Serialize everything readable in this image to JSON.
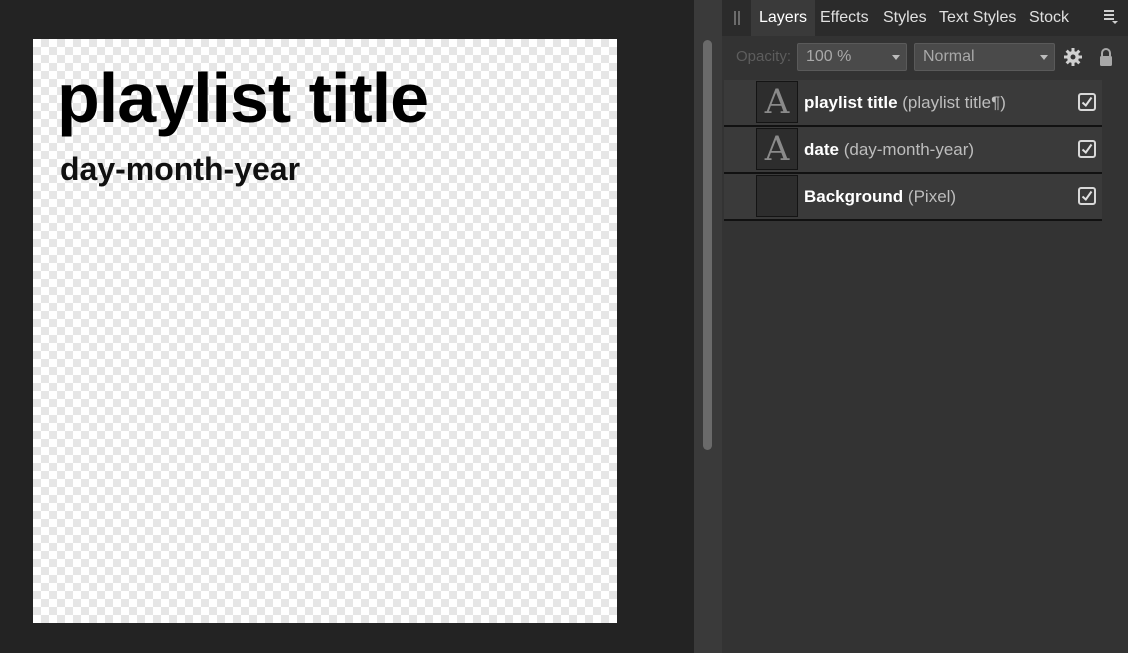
{
  "canvas": {
    "title_text": "playlist title",
    "date_text": "day-month-year"
  },
  "panel": {
    "tabs": [
      "Layers",
      "Effects",
      "Styles",
      "Text Styles",
      "Stock"
    ],
    "active_tab": "Layers",
    "opacity_label": "Opacity:",
    "opacity_value": "100 %",
    "blend_mode": "Normal"
  },
  "layers": [
    {
      "name": "playlist title",
      "type": "(playlist title¶)",
      "thumb": "A",
      "visible": true
    },
    {
      "name": "date",
      "type": "(day-month-year)",
      "thumb": "A",
      "visible": true
    },
    {
      "name": "Background",
      "type": "(Pixel)",
      "thumb": "",
      "visible": true
    }
  ],
  "colors": {
    "workspace": "#232323",
    "panel": "#333333",
    "layer_row": "#3a3a3a"
  }
}
